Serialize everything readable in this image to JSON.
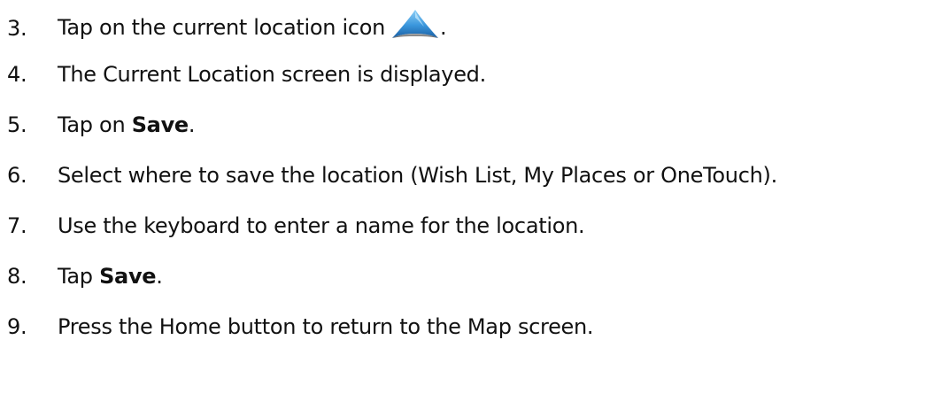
{
  "steps": [
    {
      "number": "3.",
      "before": "Tap on the current location icon",
      "after": ".",
      "icon": "current-location-arrow-icon"
    },
    {
      "number": "4.",
      "text": "The Current Location screen is displayed."
    },
    {
      "number": "5.",
      "before": "Tap on ",
      "bold": "Save",
      "after": "."
    },
    {
      "number": "6.",
      "text": "Select where to save the location (Wish List, My Places or OneTouch)."
    },
    {
      "number": "7.",
      "text": "Use the keyboard to enter a name for the location."
    },
    {
      "number": "8.",
      "before": "Tap ",
      "bold": "Save",
      "after": "."
    },
    {
      "number": "9.",
      "text": "Press the Home button to return to the Map screen."
    }
  ],
  "colors": {
    "text": "#111111",
    "icon_light": "#7ec3f0",
    "icon_dark": "#1e6fb8"
  }
}
